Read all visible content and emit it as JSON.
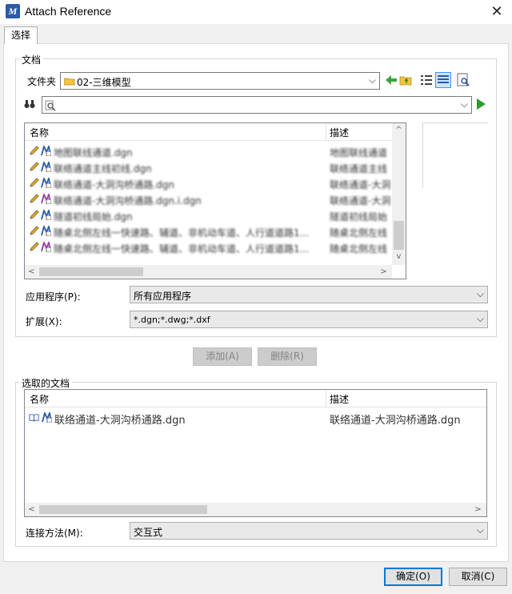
{
  "window": {
    "title": "Attach Reference",
    "close_glyph": "✕"
  },
  "tab": {
    "label": "选择"
  },
  "document_group": {
    "label": "文档",
    "folder_label": "文件夹",
    "folder_value": "02-三维模型",
    "file_list": {
      "columns": [
        "名称",
        "描述"
      ],
      "rows": [
        {
          "name": "地图联线通道.dgn",
          "desc": "地图联线通道"
        },
        {
          "name": "联络通道主线初线.dgn",
          "desc": "联络通道主线"
        },
        {
          "name": "联络通道-大洞沟桥通路.dgn",
          "desc": "联络通道-大洞"
        },
        {
          "name": "联络通道-大洞沟桥通路.dgn.i.dgn",
          "desc": "联络通道-大洞"
        },
        {
          "name": "隧道初线局始.dgn",
          "desc": "隧道初线局始"
        },
        {
          "name": "随桌北侧左线一快速路、辅道、非机动车道、人行道道路1...",
          "desc": "随桌北侧左线"
        },
        {
          "name": "随桌北侧左线一快速路、辅道、非机动车道、人行道道路1...",
          "desc": "随桌北侧左线"
        }
      ]
    },
    "application_label": "应用程序(P):",
    "application_value": "所有应用程序",
    "extension_label": "扩展(X):",
    "extension_value": "*.dgn;*.dwg;*.dxf"
  },
  "buttons": {
    "add": "添加(A)",
    "remove": "删除(R)",
    "ok": "确定(O)",
    "cancel": "取消(C)"
  },
  "selected_group": {
    "label": "选取的文档",
    "columns": [
      "名称",
      "描述"
    ],
    "rows": [
      {
        "name": "联络通道-大洞沟桥通路.dgn",
        "desc": "联络通道-大洞沟桥通路.dgn"
      }
    ],
    "attach_method_label": "连接方法(M):",
    "attach_method_value": "交互式"
  },
  "glyphs": {
    "chevron_down": "⌵",
    "arrow_left": "<",
    "arrow_right": ">",
    "arrow_up": "^",
    "arrow_down": "v"
  },
  "colors": {
    "accent": "#0078d7",
    "go_green": "#2a9d2a",
    "app_icon_blue": "#2a5aa8"
  }
}
